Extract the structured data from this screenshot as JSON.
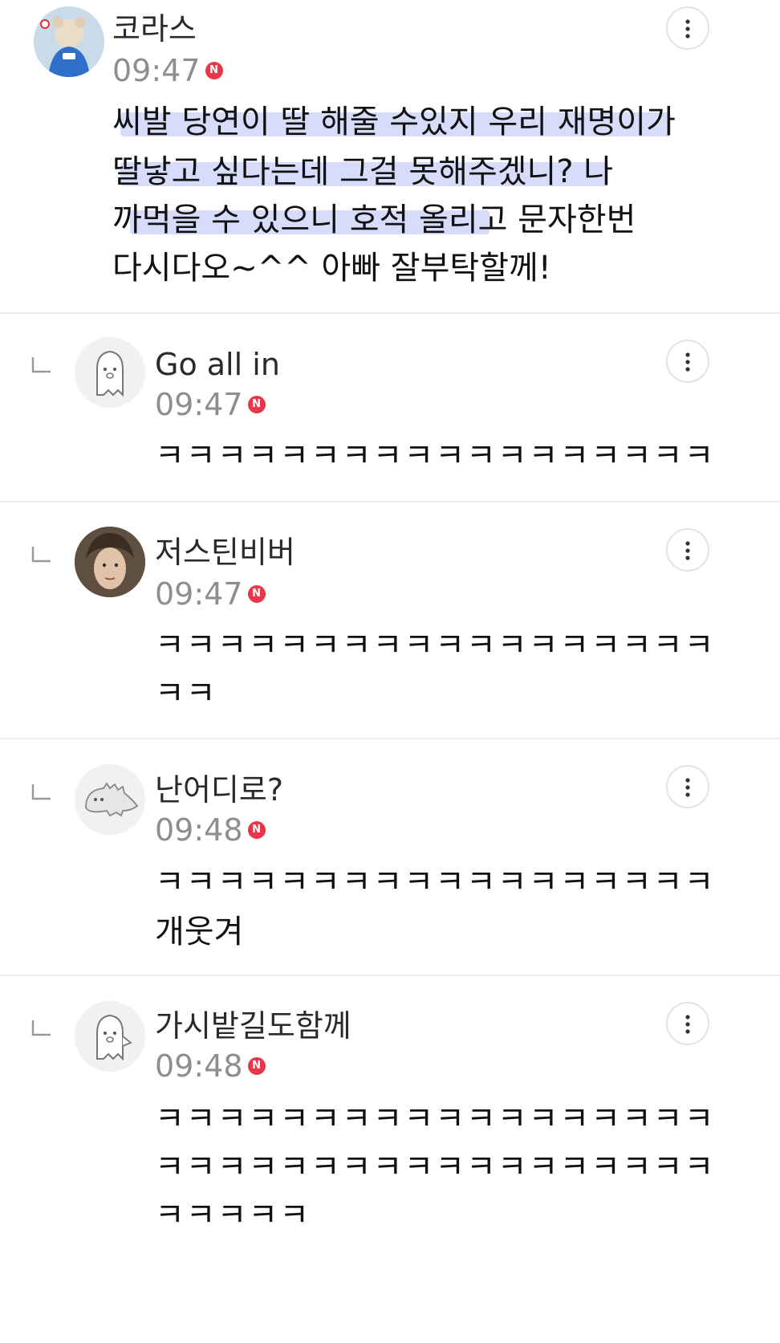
{
  "comments": [
    {
      "author": "코라스",
      "time": "09:47",
      "badge": "N",
      "avatar_icon": "mascot-avatar-icon",
      "is_reply": false,
      "lines": [
        "씨발 당연이 딸 해줄 수있지 우리 재명이가",
        "딸낳고 싶다는데 그걸 못해주겠니? 나",
        "까먹을 수 있으니 호적 올리고 문자한번",
        "다시다오~^^ 아빠 잘부탁할께!"
      ]
    },
    {
      "author": "Go all in",
      "time": "09:47",
      "badge": "N",
      "avatar_icon": "ghost-avatar-icon",
      "is_reply": true,
      "lines": [
        "ㅋㅋㅋㅋㅋㅋㅋㅋㅋㅋㅋㅋㅋㅋㅋㅋㅋㅋ"
      ]
    },
    {
      "author": "저스틴비버",
      "time": "09:47",
      "badge": "N",
      "avatar_icon": "photo-avatar-icon",
      "is_reply": true,
      "lines": [
        "ㅋㅋㅋㅋㅋㅋㅋㅋㅋㅋㅋㅋㅋㅋㅋㅋㅋㅋ",
        "ㅋㅋ"
      ]
    },
    {
      "author": "난어디로?",
      "time": "09:48",
      "badge": "N",
      "avatar_icon": "dino-avatar-icon",
      "is_reply": true,
      "lines": [
        "ㅋㅋㅋㅋㅋㅋㅋㅋㅋㅋㅋㅋㅋㅋㅋㅋㅋㅋ",
        "개웃겨"
      ]
    },
    {
      "author": "가시밭길도함께",
      "time": "09:48",
      "badge": "N",
      "avatar_icon": "ghost-avatar-icon",
      "is_reply": true,
      "lines": [
        "ㅋㅋㅋㅋㅋㅋㅋㅋㅋㅋㅋㅋㅋㅋㅋㅋㅋㅋ",
        "ㅋㅋㅋㅋㅋㅋㅋㅋㅋㅋㅋㅋㅋㅋㅋㅋㅋㅋ",
        "ㅋㅋㅋㅋㅋ"
      ]
    }
  ],
  "colors": {
    "badge": "#e8364a",
    "highlight": "#d8dcfb",
    "divider": "#ececec",
    "time": "#8e8e8e"
  }
}
